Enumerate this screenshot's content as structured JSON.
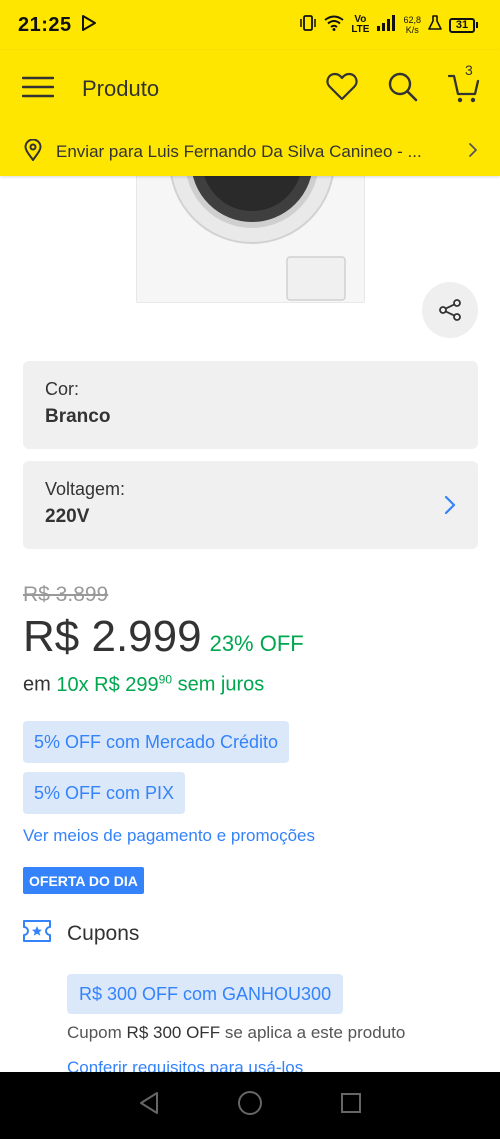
{
  "status_bar": {
    "time": "21:25",
    "network": "Vo\nLTE",
    "speed": "62,8\nK/s",
    "battery": "31"
  },
  "header": {
    "title": "Produto",
    "cart_count": "3",
    "address": "Enviar para Luis Fernando Da Silva Canineo - ..."
  },
  "variants": [
    {
      "label": "Cor:",
      "value": "Branco"
    },
    {
      "label": "Voltagem:",
      "value": "220V"
    }
  ],
  "pricing": {
    "old_price": "R$ 3.899",
    "price": "R$ 2.999",
    "discount": "23% OFF",
    "installments_prefix": "em",
    "installments_count": "10x R$ 299",
    "installments_cents": "90",
    "installments_suffix": "sem juros"
  },
  "promotions": [
    "5% OFF com Mercado Crédito",
    "5% OFF com PIX"
  ],
  "payments_link": "Ver meios de pagamento e promoções",
  "deal_badge": "OFERTA DO DIA",
  "coupons": {
    "title": "Cupons",
    "chip": "R$ 300 OFF com GANHOU300",
    "desc_prefix": "Cupom",
    "desc_amount": "R$ 300 OFF",
    "desc_suffix": "se aplica a este produto",
    "link": "Conferir requisitos para usá-los"
  },
  "colors": {
    "brand_yellow": "#ffe600",
    "link_blue": "#3483fa",
    "green": "#00a650",
    "chip_bg": "#dbe8f9"
  }
}
